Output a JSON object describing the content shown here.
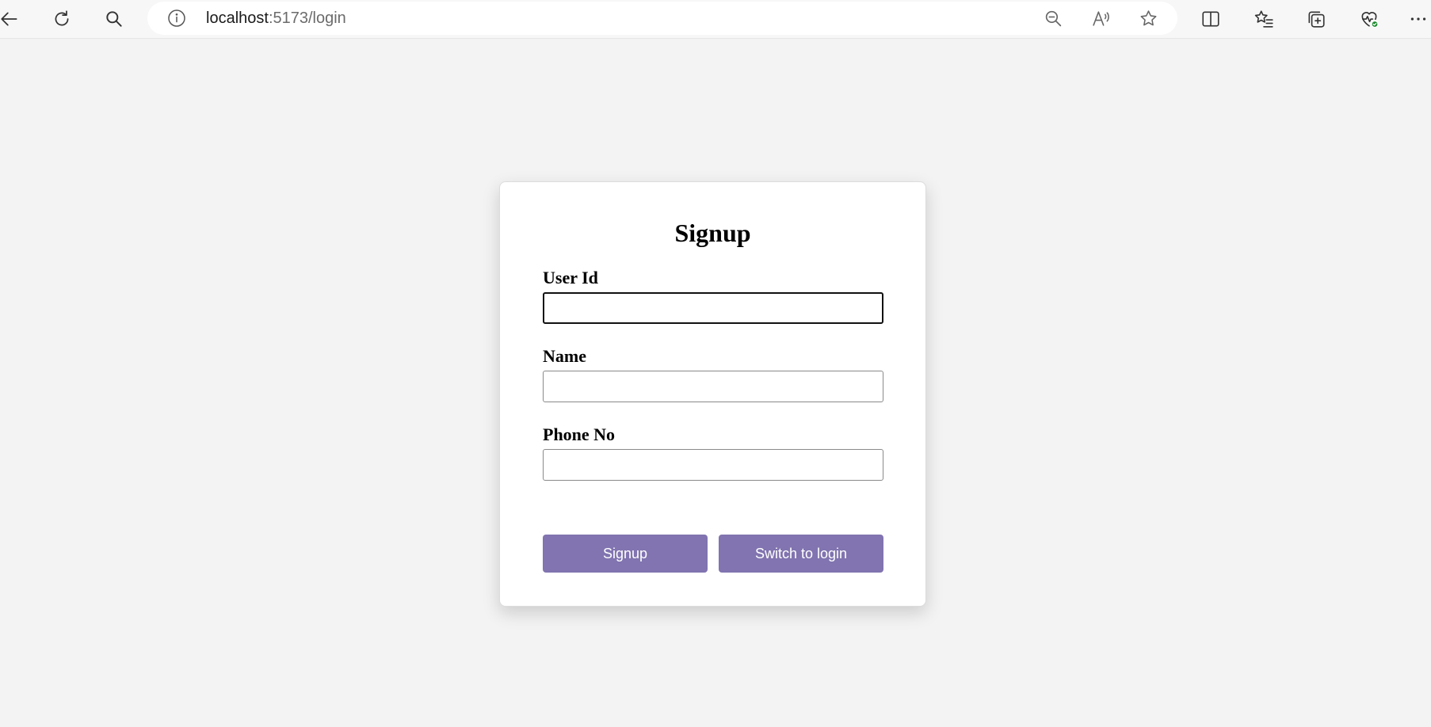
{
  "browser": {
    "url_host": "localhost",
    "url_path": ":5173/login",
    "icons": {
      "back": "back-arrow-icon",
      "refresh": "refresh-icon",
      "search": "search-icon",
      "site_info": "info-icon",
      "zoom_out": "zoom-out-icon",
      "read_aloud": "read-aloud-icon",
      "favorite": "star-icon",
      "split_screen": "split-screen-icon",
      "favorites": "favorites-list-icon",
      "collections": "collections-icon",
      "browser_essentials": "heart-pulse-icon",
      "more": "more-icon"
    }
  },
  "form": {
    "title": "Signup",
    "fields": [
      {
        "label": "User Id",
        "value": "",
        "focused": true
      },
      {
        "label": "Name",
        "value": ""
      },
      {
        "label": "Phone No",
        "value": ""
      }
    ],
    "buttons": {
      "signup": "Signup",
      "switch": "Switch to login"
    }
  },
  "colors": {
    "page_bg": "#f3f3f3",
    "button_bg": "#8174b0",
    "button_text": "#ffffff",
    "essentials_badge": "#1a8a2c"
  }
}
